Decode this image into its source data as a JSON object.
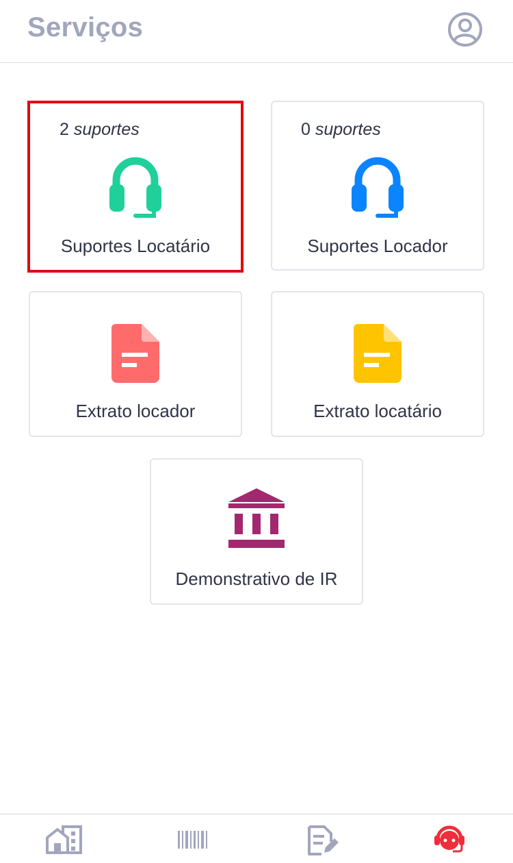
{
  "header": {
    "title": "Serviços",
    "profile_icon": "user-circle-icon"
  },
  "cards": [
    {
      "count_number": "2",
      "count_word": "suportes",
      "label": "Suportes Locatário",
      "icon": "headset-icon",
      "color": "#1fd09b",
      "selected": true
    },
    {
      "count_number": "0",
      "count_word": "suportes",
      "label": "Suportes Locador",
      "icon": "headset-icon",
      "color": "#0a84ff",
      "selected": false
    },
    {
      "label": "Extrato locador",
      "icon": "document-icon",
      "color": "#ff6b6b"
    },
    {
      "label": "Extrato locatário",
      "icon": "document-icon",
      "color": "#ffc400"
    },
    {
      "label": "Demonstrativo de IR",
      "icon": "bank-icon",
      "color": "#a3286f"
    }
  ],
  "highlight_color": "#e3000f",
  "tabbar": {
    "items": [
      {
        "icon": "buildings-icon",
        "color": "#a1a6bb",
        "active": false
      },
      {
        "icon": "barcode-icon",
        "color": "#a1a6bb",
        "active": false
      },
      {
        "icon": "document-edit-icon",
        "color": "#a1a6bb",
        "active": false
      },
      {
        "icon": "support-agent-icon",
        "color": "#f02d3a",
        "active": true
      }
    ]
  }
}
